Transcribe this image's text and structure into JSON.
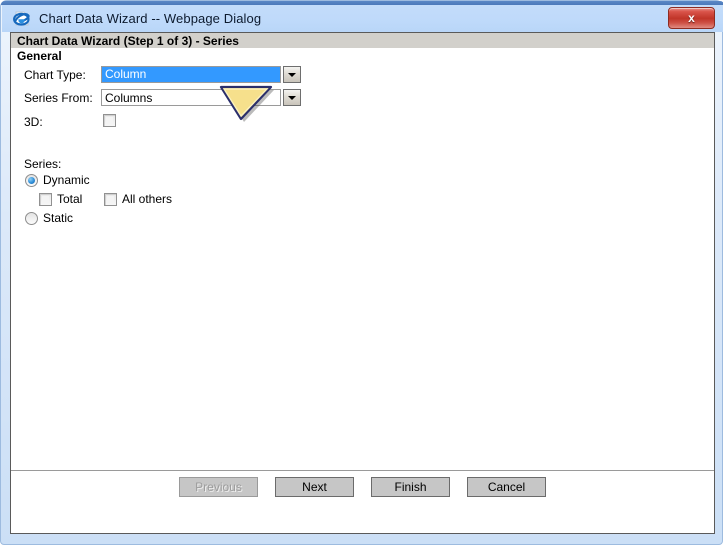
{
  "window": {
    "title": "Chart Data Wizard -- Webpage Dialog",
    "app_icon": "internet-explorer-icon",
    "close_label": "x",
    "frame_color": "#bdd9f7",
    "title_bar_color": "#bfdafa"
  },
  "header": {
    "title": "Chart Data Wizard (Step 1 of 3) - Series",
    "subtitle": "General",
    "band_color": "#d2d0cb"
  },
  "form": {
    "chart_type": {
      "label": "Chart Type:",
      "value": "Column",
      "selected": true,
      "highlight_color": "#3399ff",
      "dropdown_icon": "chevron-down-icon"
    },
    "series_from": {
      "label": "Series From:",
      "value": "Columns",
      "selected": false,
      "dropdown_icon": "chevron-down-icon"
    },
    "three_d": {
      "label": "3D:",
      "checked": false
    }
  },
  "series": {
    "label": "Series:",
    "options": [
      {
        "label": "Dynamic",
        "selected": true
      },
      {
        "label": "Static",
        "selected": false
      }
    ],
    "checkboxes": [
      {
        "label": "Total",
        "checked": false
      },
      {
        "label": "All others",
        "checked": false
      }
    ]
  },
  "cursor": {
    "icon": "arrow-pointer-cursor",
    "fill_color": "#f7e08a",
    "outline_color": "#2b2f6b"
  },
  "footer": {
    "buttons": [
      {
        "label": "Previous",
        "disabled": true
      },
      {
        "label": "Next",
        "disabled": false
      },
      {
        "label": "Finish",
        "disabled": false
      },
      {
        "label": "Cancel",
        "disabled": false
      }
    ]
  }
}
